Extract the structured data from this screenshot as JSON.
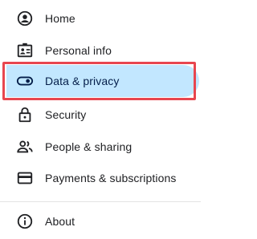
{
  "nav": {
    "items": [
      {
        "label": "Home",
        "icon": "home-person-icon"
      },
      {
        "label": "Personal info",
        "icon": "id-card-icon"
      },
      {
        "label": "Data & privacy",
        "icon": "toggle-icon",
        "selected": true
      },
      {
        "label": "Security",
        "icon": "lock-icon"
      },
      {
        "label": "People & sharing",
        "icon": "people-icon"
      },
      {
        "label": "Payments & subscriptions",
        "icon": "credit-card-icon"
      }
    ],
    "footer": [
      {
        "label": "About",
        "icon": "info-icon"
      }
    ]
  },
  "colors": {
    "selected_bg": "#c2e7ff",
    "highlight_border": "#e8464f",
    "text": "#202124"
  }
}
